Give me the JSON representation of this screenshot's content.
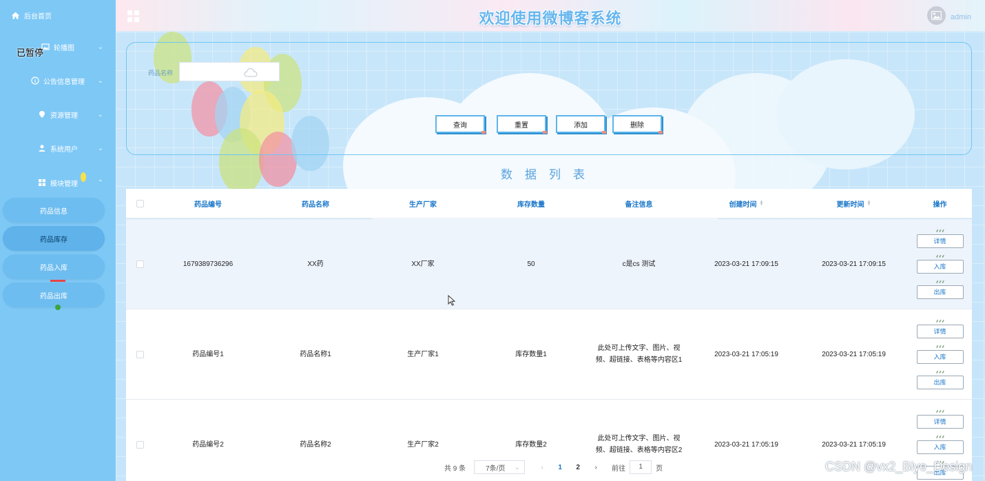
{
  "header": {
    "title": "欢迎使用微博客系统",
    "user": "admin"
  },
  "overlay": {
    "paused": "已暂停"
  },
  "sidebar": {
    "home": "后台首页",
    "menus": [
      {
        "label": "轮播图",
        "icon": "image-icon"
      },
      {
        "label": "公告信息管理",
        "icon": "info-icon"
      },
      {
        "label": "资源管理",
        "icon": "location-icon"
      },
      {
        "label": "系统用户",
        "icon": "user-icon"
      },
      {
        "label": "模块管理",
        "icon": "grid-icon"
      }
    ],
    "submenu": [
      "药品信息",
      "药品库存",
      "药品入库",
      "药品出库"
    ]
  },
  "search": {
    "label": "药品名称",
    "value": ""
  },
  "toolbar": {
    "query": "查询",
    "reset": "重置",
    "add": "添加",
    "delete": "删除"
  },
  "list": {
    "title": "数据列表",
    "columns": [
      "药品编号",
      "药品名称",
      "生产厂家",
      "库存数量",
      "备注信息",
      "创建时间",
      "更新时间",
      "操作"
    ],
    "rows": [
      {
        "code": "1679389736296",
        "name": "XX药",
        "maker": "XX厂家",
        "stock": "50",
        "note": "c是cs 测试",
        "created": "2023-03-21 17:09:15",
        "updated": "2023-03-21 17:09:15"
      },
      {
        "code": "药品编号1",
        "name": "药品名称1",
        "maker": "生产厂家1",
        "stock": "库存数量1",
        "note": "此处可上传文字、图片、视频、超链接、表格等内容区1",
        "created": "2023-03-21 17:05:19",
        "updated": "2023-03-21 17:05:19"
      },
      {
        "code": "药品编号2",
        "name": "药品名称2",
        "maker": "生产厂家2",
        "stock": "库存数量2",
        "note": "此处可上传文字、图片、视频、超链接、表格等内容区2",
        "created": "2023-03-21 17:05:19",
        "updated": "2023-03-21 17:05:19"
      }
    ],
    "actions": [
      "详情",
      "入库",
      "出库"
    ]
  },
  "pagination": {
    "total": "共 9 条",
    "page_size": "7条/页",
    "pages": [
      "1",
      "2"
    ],
    "current": "1",
    "goto_prefix": "前往",
    "goto_value": "1",
    "goto_suffix": "页"
  },
  "watermark": "CSDN @vx2_Biye_Design",
  "colors": {
    "sidebar": "#7ec8f6",
    "accent": "#5aa2dd",
    "header_text": "#1976c9"
  }
}
